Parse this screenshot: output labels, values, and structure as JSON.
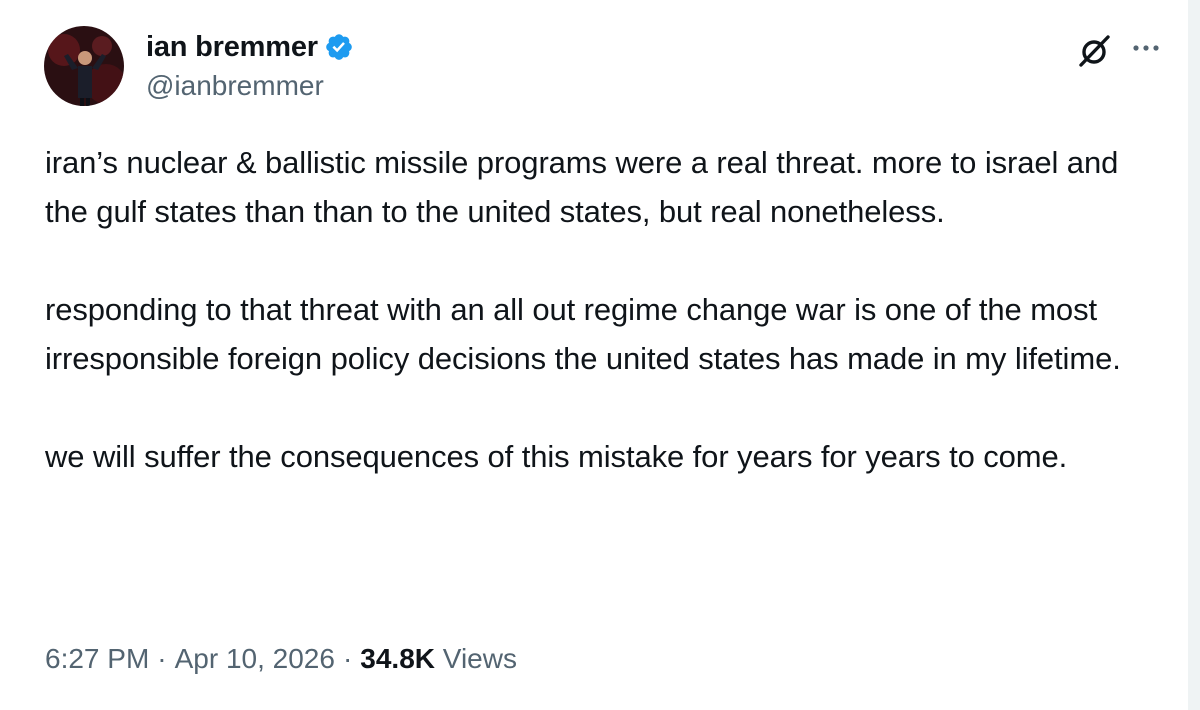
{
  "author": {
    "display_name": "ian bremmer",
    "handle": "@ianbremmer",
    "verified": true
  },
  "icons": {
    "verified": "verified-badge-icon",
    "grok": "grok-icon",
    "more": "more-options-icon"
  },
  "colors": {
    "text": "#0f1419",
    "secondary": "#536471",
    "verified": "#1d9bf0"
  },
  "tweet": {
    "paragraphs": [
      "iran’s nuclear & ballistic missile programs were a real threat. more to israel and the gulf states than than to the united states, but real nonetheless.",
      "responding to that threat with an all out regime change war is one of the most irresponsible foreign policy decisions the united states has made in my lifetime.",
      "we will suffer the consequences of this mistake for years for years to come."
    ]
  },
  "meta": {
    "time": "6:27 PM",
    "separator": "·",
    "date": "Apr 10, 2026",
    "views_count": "34.8K",
    "views_label": "Views"
  }
}
